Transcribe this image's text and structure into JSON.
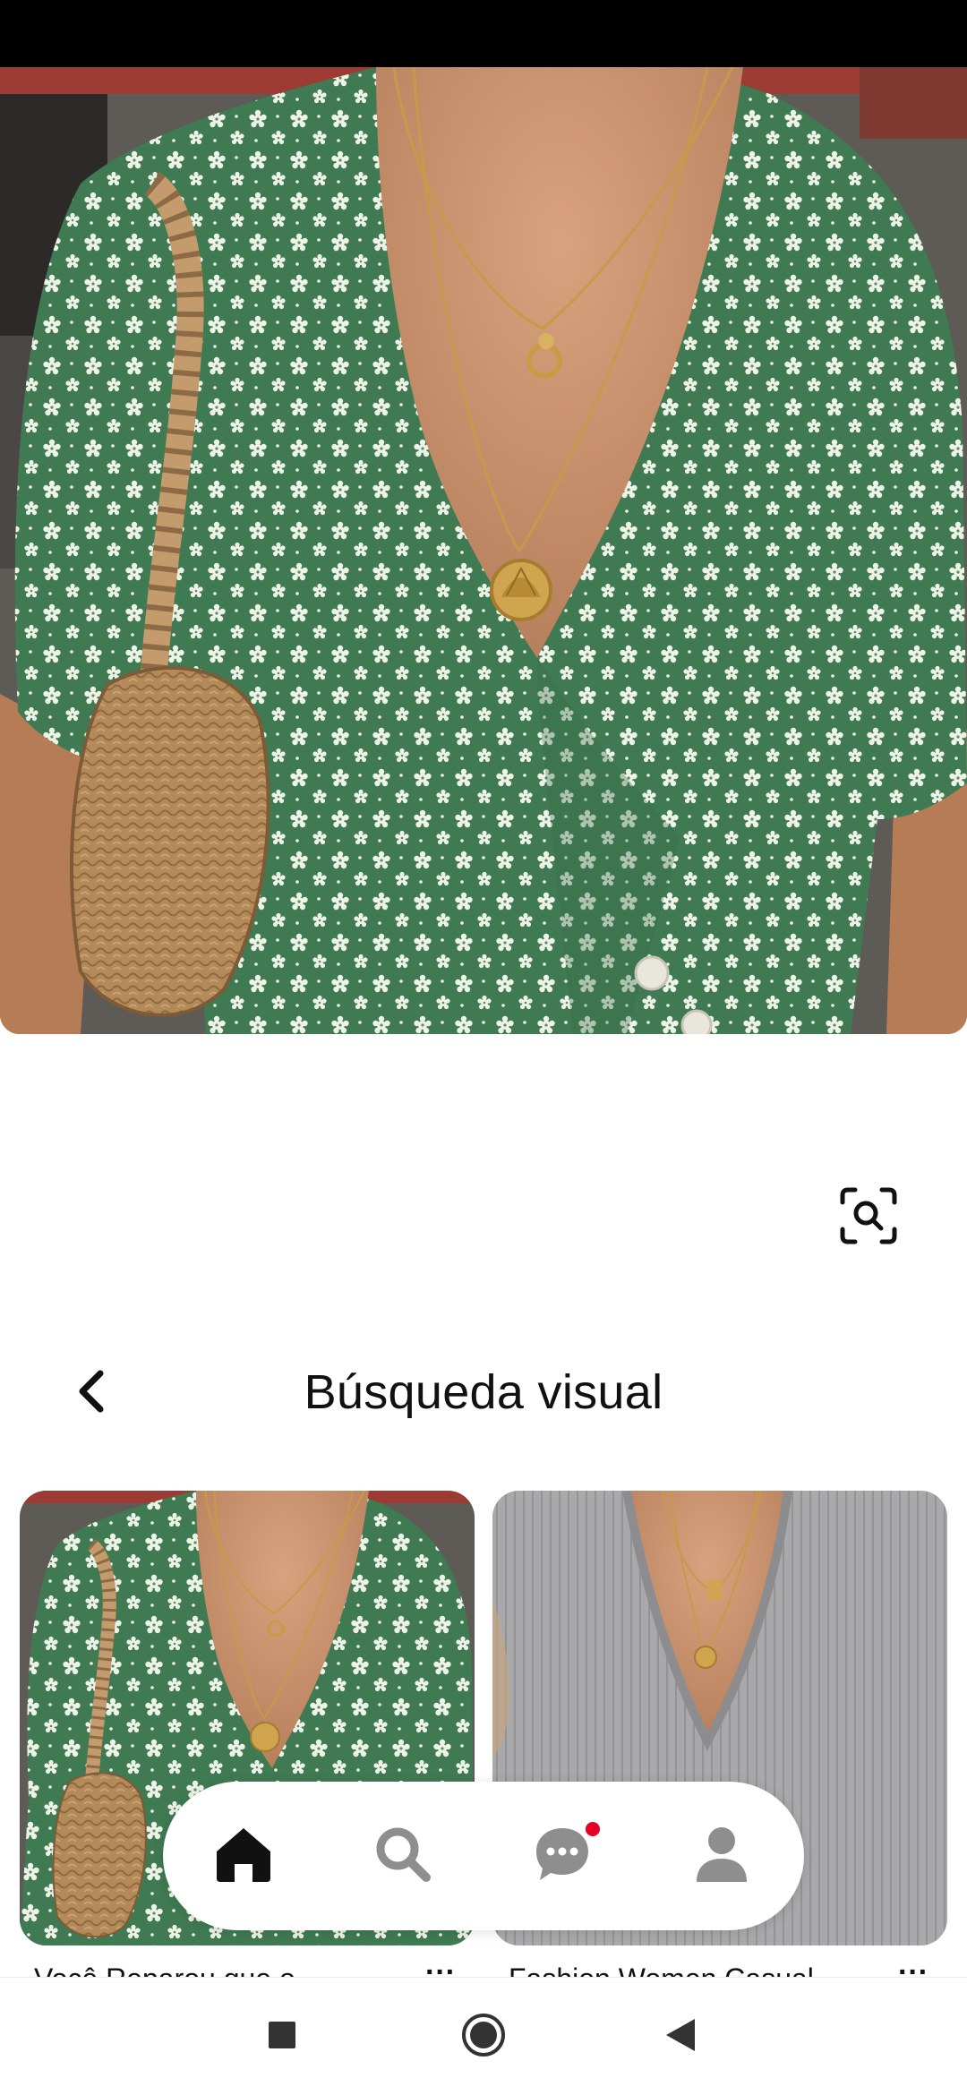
{
  "header": {
    "title": "Búsqueda visual"
  },
  "results": [
    {
      "caption": "Você Reparou que o...",
      "image": "green-floral-wrap-dress-with-necklaces-and-straw-bag",
      "more_label": "···"
    },
    {
      "caption": "Fashion Women Casual...",
      "image": "grey-knit-v-neck-sweater-with-gold-necklaces",
      "more_label": "···"
    }
  ],
  "hero": {
    "image": "green-floral-wrap-dress-with-layered-gold-necklaces"
  },
  "icons": {
    "lens": "visual-search-icon",
    "back": "chevron-left-icon",
    "home": "home-icon",
    "search": "search-icon",
    "messages": "chat-bubble-icon",
    "profile": "profile-icon"
  },
  "tabbar": {
    "active_tab": "home",
    "messages_has_notification": true
  },
  "colors": {
    "accent": "#e60023",
    "active_icon": "#111111",
    "inactive_icon": "#8e8e8e",
    "dress_green": "#3f7a52"
  }
}
